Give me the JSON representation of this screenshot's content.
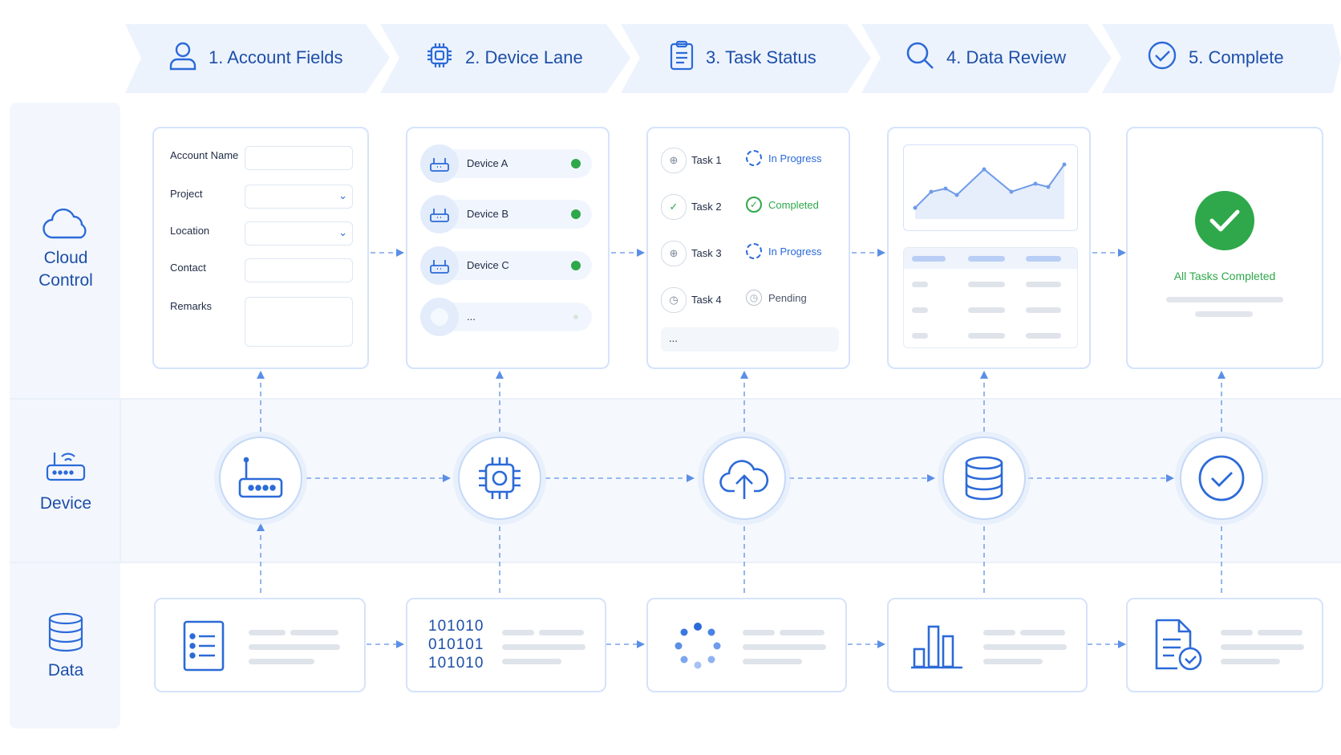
{
  "steps": [
    {
      "label": "1. Account Fields",
      "icon": "user-icon"
    },
    {
      "label": "2. Device Lane",
      "icon": "chip-icon"
    },
    {
      "label": "3. Task Status",
      "icon": "clipboard-icon"
    },
    {
      "label": "4. Data Review",
      "icon": "search-icon"
    },
    {
      "label": "5. Complete",
      "icon": "check-circle-icon"
    }
  ],
  "lanes": [
    {
      "label": "Cloud\nControl",
      "icon": "cloud-icon"
    },
    {
      "label": "Device",
      "icon": "router-icon"
    },
    {
      "label": "Data",
      "icon": "database-icon"
    }
  ],
  "account_form": {
    "fields": [
      {
        "label": "Account Name",
        "type": "text",
        "value": ""
      },
      {
        "label": "Project",
        "type": "select",
        "value": ""
      },
      {
        "label": "Location",
        "type": "select",
        "value": ""
      },
      {
        "label": "Contact",
        "type": "text",
        "value": ""
      },
      {
        "label": "Remarks",
        "type": "textarea",
        "value": ""
      }
    ]
  },
  "device_list": {
    "items": [
      {
        "name": "Device A",
        "status_color": "#2ea84a"
      },
      {
        "name": "Device B",
        "status_color": "#2ea84a"
      },
      {
        "name": "Device C",
        "status_color": "#2ea84a"
      },
      {
        "name": "...",
        "status_color": "#d8e6d8"
      }
    ]
  },
  "task_list": {
    "items": [
      {
        "name": "Task 1",
        "status": "In Progress",
        "status_color": "#2c6ad8"
      },
      {
        "name": "Task 2",
        "status": "Completed",
        "status_color": "#2ea84a"
      },
      {
        "name": "Task 3",
        "status": "In Progress",
        "status_color": "#2c6ad8"
      },
      {
        "name": "Task 4",
        "status": "Pending",
        "status_color": "#4a5568"
      }
    ],
    "more": "..."
  },
  "complete_panel": {
    "message": "All Tasks Completed",
    "color": "#2ea84a"
  },
  "device_nodes": [
    "router-icon",
    "chip-icon",
    "cloud-upload-icon",
    "database-icon",
    "check-circle-icon"
  ],
  "data_cards": {
    "binary_lines": [
      "101010",
      "010101",
      "101010"
    ],
    "icons": [
      "list-document-icon",
      "binary-icon",
      "loading-spinner-icon",
      "bar-chart-icon",
      "document-check-icon"
    ]
  },
  "colors": {
    "accent": "#2c6ad8",
    "accent_dark": "#1d4fa8",
    "success": "#2ea84a",
    "lane_bg": "#f3f7fd",
    "step_bg": "#edf3fd"
  }
}
